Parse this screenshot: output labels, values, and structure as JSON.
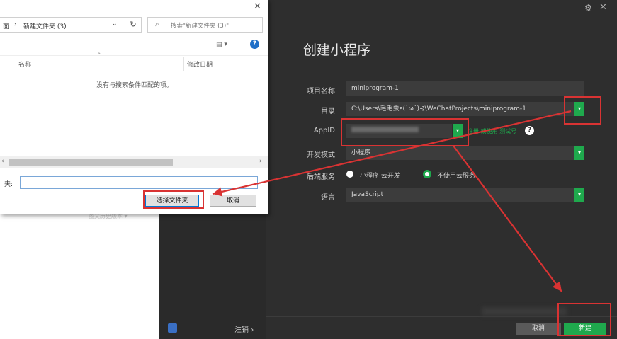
{
  "dialog": {
    "close": "✕",
    "breadcrumb_prefix": "面",
    "breadcrumb_sep": "›",
    "breadcrumb": "新建文件夹 (3)",
    "refresh": "↻",
    "search_placeholder": "搜索\"新建文件夹 (3)\"",
    "col_name": "名称",
    "col_date": "修改日期",
    "empty_msg": "没有与搜索条件匹配的项。",
    "folder_label": "夹:",
    "folder_value": "",
    "select_btn": "选择文件夹",
    "cancel_btn": "取消",
    "faint_text": "图文历史版本 ▾"
  },
  "app": {
    "title": "创建小程序",
    "project_name_label": "项目名称",
    "project_name": "miniprogram-1",
    "dir_label": "目录",
    "dir_value": "C:\\Users\\毛毛虫ε(˙ω˙)⊰\\WeChatProjects\\miniprogram-1",
    "appid_label": "AppID",
    "appid_extra": "注册 或使用 测试号",
    "appid_help": "?",
    "mode_label": "开发模式",
    "mode_value": "小程序",
    "backend_label": "后端服务",
    "backend_opt1": "小程序·云开发",
    "backend_opt2": "不使用云服务",
    "lang_label": "语言",
    "lang_value": "JavaScript",
    "cancel": "取消",
    "create": "新建",
    "logout": "注销",
    "logout_arrow": "›",
    "gear": "⚙",
    "close": "✕"
  },
  "colors": {
    "accent": "#1fa94d",
    "annotation": "#d93333"
  }
}
